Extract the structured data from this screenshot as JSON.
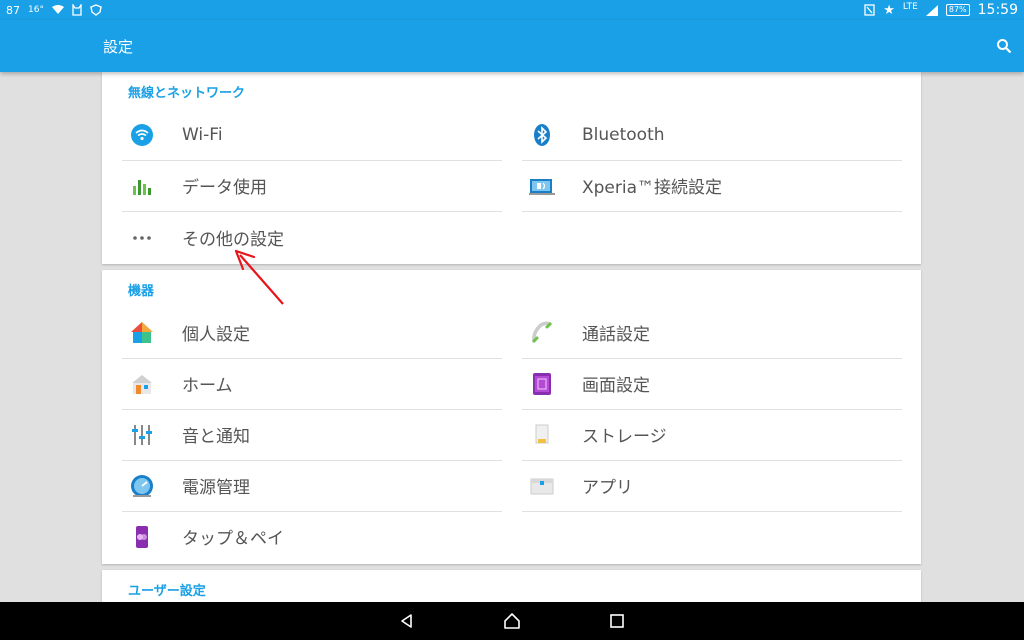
{
  "status_bar": {
    "left_items": [
      "87",
      "16°"
    ],
    "battery": "87%",
    "network": "LTE",
    "time": "15:59"
  },
  "app_bar": {
    "title": "設定"
  },
  "sections": {
    "network": {
      "header": "無線とネットワーク",
      "items": [
        {
          "label": "Wi-Fi",
          "icon": "wifi-icon"
        },
        {
          "label": "Bluetooth",
          "icon": "bluetooth-icon"
        },
        {
          "label": "データ使用",
          "icon": "data-usage-icon"
        },
        {
          "label": "Xperia™接続設定",
          "icon": "xperia-connectivity-icon"
        },
        {
          "label": "その他の設定",
          "icon": "more-icon"
        }
      ]
    },
    "device": {
      "header": "機器",
      "items": [
        {
          "label": "個人設定",
          "icon": "personalization-icon"
        },
        {
          "label": "通話設定",
          "icon": "call-icon"
        },
        {
          "label": "ホーム",
          "icon": "home-icon"
        },
        {
          "label": "画面設定",
          "icon": "display-icon"
        },
        {
          "label": "音と通知",
          "icon": "sound-icon"
        },
        {
          "label": "ストレージ",
          "icon": "storage-icon"
        },
        {
          "label": "電源管理",
          "icon": "power-icon"
        },
        {
          "label": "アプリ",
          "icon": "apps-icon"
        },
        {
          "label": "タップ＆ペイ",
          "icon": "tap-pay-icon"
        }
      ]
    },
    "user": {
      "header": "ユーザー設定"
    }
  },
  "colors": {
    "accent": "#1aa0e6",
    "annotation": "#e8141b"
  }
}
